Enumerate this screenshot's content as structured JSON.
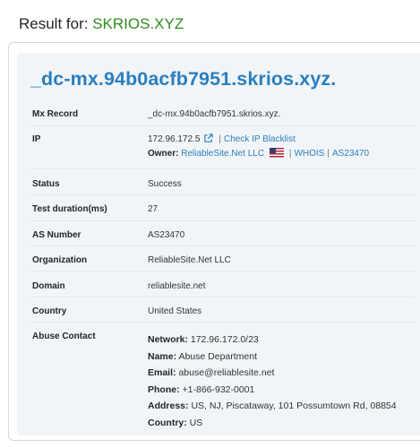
{
  "header": {
    "prefix": "Result for:",
    "domain": "SKRIOS.XYZ"
  },
  "hostname": "_dc-mx.94b0acfb7951.skrios.xyz.",
  "rows": {
    "mx": {
      "label": "Mx Record",
      "value": "_dc-mx.94b0acfb7951.skrios.xyz."
    },
    "ip": {
      "label": "IP",
      "value": "172.96.172.5",
      "blacklist_link": "Check IP Blacklist",
      "owner_label": "Owner:",
      "owner": "ReliableSite.Net LLC",
      "whois": "WHOIS",
      "as": "AS23470"
    },
    "status": {
      "label": "Status",
      "value": "Success"
    },
    "duration": {
      "label": "Test duration(ms)",
      "value": "27"
    },
    "asn": {
      "label": "AS Number",
      "value": "AS23470"
    },
    "org": {
      "label": "Organization",
      "value": "ReliableSite.Net LLC"
    },
    "domain": {
      "label": "Domain",
      "value": "reliablesite.net"
    },
    "country": {
      "label": "Country",
      "value": "United States"
    },
    "abuse": {
      "label": "Abuse Contact",
      "network_label": "Network:",
      "network": "172.96.172.0/23",
      "name_label": "Name:",
      "name": "Abuse Department",
      "email_label": "Email:",
      "email": "abuse@reliablesite.net",
      "phone_label": "Phone:",
      "phone": "+1-866-932-0001",
      "address_label": "Address:",
      "address": "US, NJ, Piscataway, 101 Possumtown Rd, 08854",
      "country_label": "Country:",
      "country": "US"
    }
  }
}
